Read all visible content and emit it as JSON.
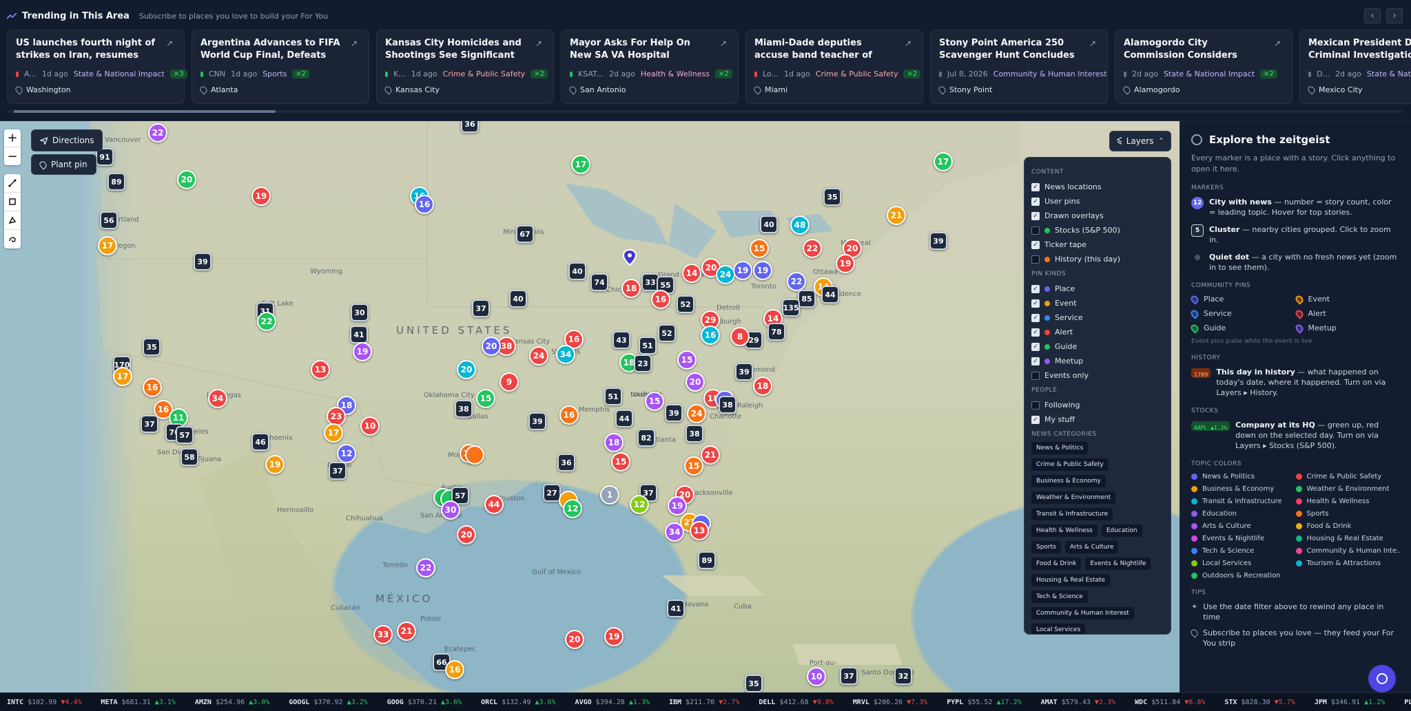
{
  "trending": {
    "title": "Trending in This Area",
    "subtitle": "Subscribe to places you love to build your For You",
    "cards": [
      {
        "title": "US launches fourth night of strikes on Iran, resumes naval...",
        "source": "A...",
        "time": "1d ago",
        "category": "State & National Impact",
        "count": "×3",
        "location": "Washington",
        "src_color": "#ef4444"
      },
      {
        "title": "Argentina Advances to FIFA World Cup Final, Defeats Engla...",
        "source": "CNN",
        "time": "1d ago",
        "category": "Sports",
        "count": "×2",
        "location": "Atlanta",
        "src_color": "#22c55e"
      },
      {
        "title": "Kansas City Homicides and Shootings See Significant Decli...",
        "source": "K...",
        "time": "1d ago",
        "category": "Crime & Public Safety",
        "count": "×2",
        "location": "Kansas City",
        "src_color": "#22c55e"
      },
      {
        "title": "Mayor Asks For Help On New SA VA Hospital",
        "source": "KSAT...",
        "time": "2d ago",
        "category": "Health & Wellness",
        "count": "×2",
        "location": "San Antonio",
        "src_color": "#22c55e"
      },
      {
        "title": "Miami-Dade deputies accuse band teacher of having sexual...",
        "source": "Lo...",
        "time": "1d ago",
        "category": "Crime & Public Safety",
        "count": "×2",
        "location": "Miami",
        "src_color": "#ef4444"
      },
      {
        "title": "Stony Point America 250 Scavenger Hunt Concludes wit...",
        "source": "",
        "time": "Jul 8, 2026",
        "category": "Community & Human Interest",
        "count": "",
        "location": "Stony Point",
        "src_color": "#64748b"
      },
      {
        "title": "Alamogordo City Commission Considers Subdivision Overhau...",
        "source": "",
        "time": "2d ago",
        "category": "State & National Impact",
        "count": "×2",
        "location": "Alamogordo",
        "src_color": "#64748b"
      },
      {
        "title": "Mexican President Dem... Criminal Investigation in",
        "source": "D...",
        "time": "2d ago",
        "category": "State & Natio",
        "count": "",
        "location": "Mexico City",
        "src_color": "#64748b"
      }
    ]
  },
  "map": {
    "directions_label": "Directions",
    "plant_pin_label": "Plant pin",
    "layers_label": "Layers",
    "zoom_in": "+",
    "zoom_out": "−",
    "labels": [
      {
        "text": "UNITED STATES"
      },
      {
        "text": "MÉXICO"
      },
      {
        "text": "Gulf of Mexico"
      },
      {
        "text": "Vancouver"
      },
      {
        "text": "Portland"
      },
      {
        "text": "Oregon"
      },
      {
        "text": "Salt Lake"
      },
      {
        "text": "Wyoming"
      },
      {
        "text": "Minneapolis"
      },
      {
        "text": "Chicago"
      },
      {
        "text": "Toronto"
      },
      {
        "text": "Montreal"
      },
      {
        "text": "Ottawa"
      },
      {
        "text": "Detroit"
      },
      {
        "text": "Kansas City"
      },
      {
        "text": "St. Louis"
      },
      {
        "text": "Oklahoma City"
      },
      {
        "text": "Dallas"
      },
      {
        "text": "Houston"
      },
      {
        "text": "Austin"
      },
      {
        "text": "San Antonio"
      },
      {
        "text": "Phoenix"
      },
      {
        "text": "Las Vegas"
      },
      {
        "text": "Los Angeles"
      },
      {
        "text": "San Diego"
      },
      {
        "text": "Tijuana"
      },
      {
        "text": "El Paso"
      },
      {
        "text": "Chihuahua"
      },
      {
        "text": "Hermosillo"
      },
      {
        "text": "Monterrey"
      },
      {
        "text": "Torreón"
      },
      {
        "text": "Culiacán"
      },
      {
        "text": "Memphis"
      },
      {
        "text": "Nashville"
      },
      {
        "text": "Atlanta"
      },
      {
        "text": "Charlotte"
      },
      {
        "text": "Raleigh"
      },
      {
        "text": "Richmond"
      },
      {
        "text": "Pittsburgh"
      },
      {
        "text": "Jacksonville"
      },
      {
        "text": "Havana"
      },
      {
        "text": "Ecatepec"
      },
      {
        "text": "Santo Domingo"
      },
      {
        "text": "Port-au-"
      },
      {
        "text": "Providence"
      },
      {
        "text": "Grand Rapids"
      },
      {
        "text": "Louisville"
      },
      {
        "text": "Cuba"
      },
      {
        "text": "Potosí"
      }
    ]
  },
  "layers": {
    "content_head": "CONTENT",
    "content": [
      {
        "label": "News locations",
        "on": true,
        "dot": ""
      },
      {
        "label": "User pins",
        "on": true,
        "dot": ""
      },
      {
        "label": "Drawn overlays",
        "on": true,
        "dot": ""
      },
      {
        "label": "Stocks (S&P 500)",
        "on": false,
        "dot": "#22c55e"
      },
      {
        "label": "Ticker tape",
        "on": true,
        "dot": ""
      },
      {
        "label": "History (this day)",
        "on": false,
        "dot": "#f97316"
      }
    ],
    "pin_head": "PIN KINDS",
    "pins": [
      {
        "label": "Place",
        "on": true,
        "dot": "#6366f1"
      },
      {
        "label": "Event",
        "on": true,
        "dot": "#f59e0b"
      },
      {
        "label": "Service",
        "on": true,
        "dot": "#3b82f6"
      },
      {
        "label": "Alert",
        "on": true,
        "dot": "#ef4444"
      },
      {
        "label": "Guide",
        "on": true,
        "dot": "#22c55e"
      },
      {
        "label": "Meetup",
        "on": true,
        "dot": "#8b5cf6"
      },
      {
        "label": "Events only",
        "on": false,
        "dot": ""
      }
    ],
    "people_head": "PEOPLE",
    "people": [
      {
        "label": "Following",
        "on": false
      },
      {
        "label": "My stuff",
        "on": true
      }
    ],
    "cat_head": "NEWS CATEGORIES",
    "categories": [
      "News & Politics",
      "Crime & Public Safety",
      "Business & Economy",
      "Weather & Environment",
      "Transit & Infrastructure",
      "Health & Wellness",
      "Education",
      "Sports",
      "Arts & Culture",
      "Food & Drink",
      "Events & Nightlife",
      "Housing & Real Estate",
      "Tech & Science",
      "Community & Human Interest",
      "Local Services",
      "Tourism & Attractions"
    ]
  },
  "side": {
    "title": "Explore the zeitgeist",
    "desc": "Every marker is a place with a story. Click anything to open it here.",
    "markers_head": "MARKERS",
    "markers": [
      {
        "badge": "12",
        "bold": "City with news",
        "text": " — number = story count, color = leading topic. Hover for top stories."
      },
      {
        "badge": "5",
        "bold": "Cluster",
        "text": " — nearby cities grouped. Click to zoom in."
      },
      {
        "badge": "",
        "bold": "Quiet dot",
        "text": " — a city with no fresh news yet (zoom in to see them)."
      }
    ],
    "pins_head": "COMMUNITY PINS",
    "pins": [
      {
        "label": "Place",
        "color": "#6366f1"
      },
      {
        "label": "Event",
        "color": "#f59e0b"
      },
      {
        "label": "Service",
        "color": "#3b82f6"
      },
      {
        "label": "Alert",
        "color": "#ef4444"
      },
      {
        "label": "Guide",
        "color": "#22c55e"
      },
      {
        "label": "Meetup",
        "color": "#8b5cf6"
      }
    ],
    "pins_note": "Event pins pulse while the event is live.",
    "history_head": "HISTORY",
    "history_badge": "1789",
    "history_bold": "This day in history",
    "history_text": " — what happened on today's date, where it happened. Turn on via Layers ▸ History.",
    "stocks_head": "STOCKS",
    "stocks_badge": "AAPL ▲1.2%",
    "stocks_bold": "Company at its HQ",
    "stocks_text": " — green up, red down on the selected day. Turn on via Layers ▸ Stocks (S&P 500).",
    "topics_head": "TOPIC COLORS",
    "topics": [
      {
        "label": "News & Politics",
        "color": "#6366f1"
      },
      {
        "label": "Crime & Public Safety",
        "color": "#ef4444"
      },
      {
        "label": "Business & Economy",
        "color": "#f59e0b"
      },
      {
        "label": "Weather & Environment",
        "color": "#22c55e"
      },
      {
        "label": "Transit & Infrastructure",
        "color": "#06b6d4"
      },
      {
        "label": "Health & Wellness",
        "color": "#f43f5e"
      },
      {
        "label": "Education",
        "color": "#8b5cf6"
      },
      {
        "label": "Sports",
        "color": "#f97316"
      },
      {
        "label": "Arts & Culture",
        "color": "#a855f7"
      },
      {
        "label": "Food & Drink",
        "color": "#eab308"
      },
      {
        "label": "Events & Nightlife",
        "color": "#d946ef"
      },
      {
        "label": "Housing & Real Estate",
        "color": "#10b981"
      },
      {
        "label": "Tech & Science",
        "color": "#3b82f6"
      },
      {
        "label": "Community & Human Inte...",
        "color": "#ec4899"
      },
      {
        "label": "Local Services",
        "color": "#84cc16"
      },
      {
        "label": "Tourism & Attractions",
        "color": "#06b6d4"
      },
      {
        "label": "Outdoors & Recreation",
        "color": "#22c55e"
      }
    ],
    "tips_head": "TIPS",
    "tips": [
      "Use the date filter above to rewind any place in time",
      "Subscribe to places you love — they feed your For You strip"
    ]
  },
  "ticker": [
    {
      "sym": "INTC",
      "price": "$102.99",
      "chg": "▼4.4%",
      "dir": "down"
    },
    {
      "sym": "META",
      "price": "$681.31",
      "chg": "▲3.1%",
      "dir": "up"
    },
    {
      "sym": "AMZN",
      "price": "$254.96",
      "chg": "▲3.0%",
      "dir": "up"
    },
    {
      "sym": "GOOGL",
      "price": "$370.92",
      "chg": "▲3.2%",
      "dir": "up"
    },
    {
      "sym": "GOOG",
      "price": "$370.21",
      "chg": "▲3.6%",
      "dir": "up"
    },
    {
      "sym": "ORCL",
      "price": "$132.49",
      "chg": "▲3.6%",
      "dir": "up"
    },
    {
      "sym": "AVGO",
      "price": "$394.28",
      "chg": "▲1.3%",
      "dir": "up"
    },
    {
      "sym": "IBM",
      "price": "$211.70",
      "chg": "▼2.7%",
      "dir": "down"
    },
    {
      "sym": "DELL",
      "price": "$412.68",
      "chg": "▼9.8%",
      "dir": "down"
    },
    {
      "sym": "MRVL",
      "price": "$206.26",
      "chg": "▼7.3%",
      "dir": "down"
    },
    {
      "sym": "PYPL",
      "price": "$55.52",
      "chg": "▲17.2%",
      "dir": "up"
    },
    {
      "sym": "AMAT",
      "price": "$579.43",
      "chg": "▼2.3%",
      "dir": "down"
    },
    {
      "sym": "WDC",
      "price": "$511.84",
      "chg": "▼8.8%",
      "dir": "down"
    },
    {
      "sym": "STX",
      "price": "$828.30",
      "chg": "▼5.7%",
      "dir": "down"
    },
    {
      "sym": "JPM",
      "price": "$346.91",
      "chg": "▲1.2%",
      "dir": "up"
    },
    {
      "sym": "PLTR",
      "price": "$133.9",
      "chg": "",
      "dir": "up"
    }
  ]
}
